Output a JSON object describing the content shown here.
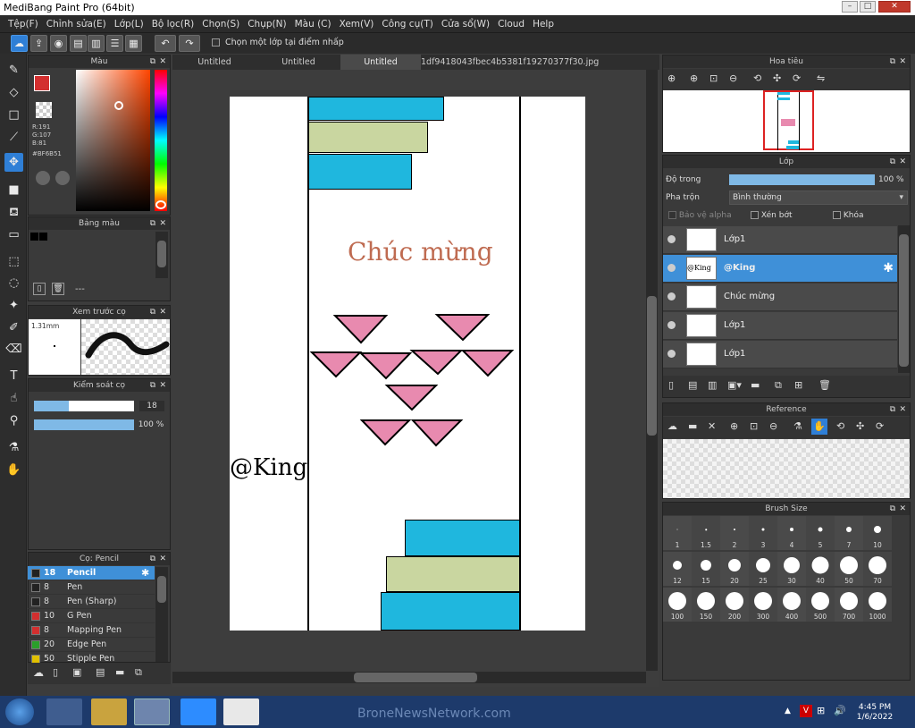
{
  "window": {
    "title": "MediBang Paint Pro (64bit)"
  },
  "menu": [
    "Tệp(F)",
    "Chỉnh sửa(E)",
    "Lớp(L)",
    "Bộ lọc(R)",
    "Chọn(S)",
    "Chụp(N)",
    "Màu (C)",
    "Xem(V)",
    "Công cụ(T)",
    "Cửa sổ(W)",
    "Cloud",
    "Help"
  ],
  "toolbar": {
    "checkbox_label": "Chọn một lớp tại điểm nhấp"
  },
  "tabs": [
    "Untitled",
    "Untitled",
    "Untitled",
    "1df9418043fbec4b5381f19270377f30.jpg"
  ],
  "color_panel": {
    "title": "Màu",
    "r": "R:191",
    "g": "G:107",
    "b": "B:81",
    "hex": "#BF6B51",
    "fg_color": "#d32f2f",
    "selected_color": "#BF6B51"
  },
  "palette": {
    "title": "Bảng màu",
    "value": "---"
  },
  "brush_preview": {
    "title": "Xem trước cọ",
    "size": "1.31mm"
  },
  "brush_control": {
    "title": "Kiểm soát cọ",
    "size_value": "18",
    "opacity_value": "100 %",
    "size_fraction": 0.35,
    "opacity_fraction": 1.0
  },
  "brush_list": {
    "title": "Cọ: Pencil",
    "items": [
      {
        "size": "18",
        "name": "Pencil",
        "color": "#222222",
        "selected": true
      },
      {
        "size": "8",
        "name": "Pen",
        "color": "#222222"
      },
      {
        "size": "8",
        "name": "Pen (Sharp)",
        "color": "#222222"
      },
      {
        "size": "10",
        "name": "G Pen",
        "color": "#d32f2f"
      },
      {
        "size": "8",
        "name": "Mapping Pen",
        "color": "#d32f2f"
      },
      {
        "size": "20",
        "name": "Edge Pen",
        "color": "#2aa02a"
      },
      {
        "size": "50",
        "name": "Stipple Pen",
        "color": "#e0c000"
      }
    ]
  },
  "canvas": {
    "greeting": "Chúc mừng",
    "signature": "@King"
  },
  "navigator": {
    "title": "Hoa tiêu"
  },
  "layers": {
    "title": "Lớp",
    "opacity_label": "Độ trong",
    "opacity_value": "100 %",
    "opacity_fraction": 1.0,
    "blend_label": "Pha trộn",
    "blend_value": "Bình thường",
    "protect_alpha": "Bảo vệ alpha",
    "clipping": "Xén bớt",
    "lock": "Khóa",
    "items": [
      {
        "name": "Lớp1",
        "selected": false
      },
      {
        "name": "@King",
        "selected": true,
        "thumb_text": "@King"
      },
      {
        "name": "Chúc mừng",
        "selected": false
      },
      {
        "name": "Lớp1",
        "selected": false
      },
      {
        "name": "Lớp1",
        "selected": false
      }
    ]
  },
  "reference": {
    "title": "Reference"
  },
  "brush_size": {
    "title": "Brush Size",
    "sizes": [
      "1",
      "1.5",
      "2",
      "3",
      "4",
      "5",
      "7",
      "10",
      "12",
      "15",
      "20",
      "25",
      "30",
      "40",
      "50",
      "70",
      "100",
      "150",
      "200",
      "300",
      "400",
      "500",
      "700",
      "1000"
    ]
  },
  "taskbar": {
    "time": "4:45 PM",
    "date": "1/6/2022",
    "background_text": "BroneNewsNetwork.com"
  }
}
